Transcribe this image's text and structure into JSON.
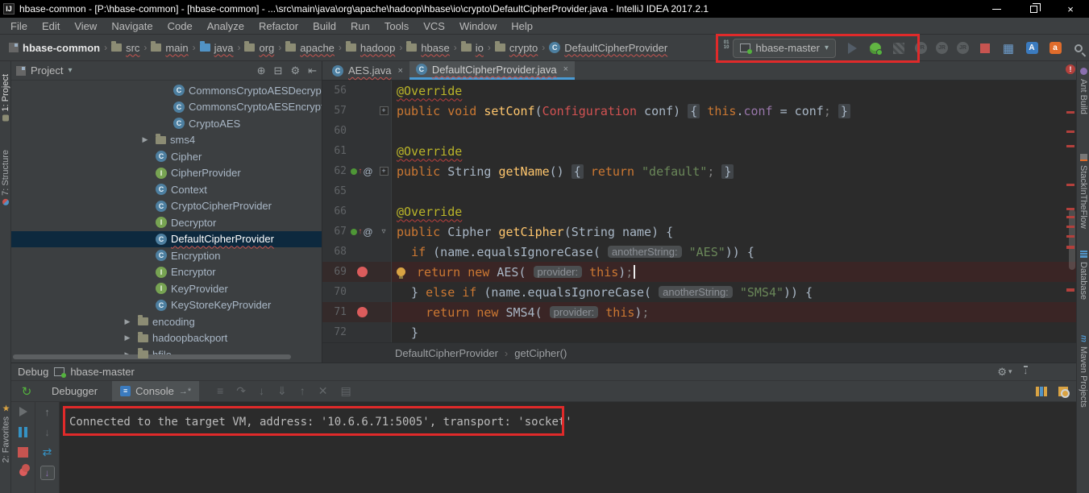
{
  "window": {
    "title": "hbase-common - [P:\\hbase-common] - [hbase-common] - ...\\src\\main\\java\\org\\apache\\hadoop\\hbase\\io\\crypto\\DefaultCipherProvider.java - IntelliJ IDEA 2017.2.1",
    "app_icon": "IJ"
  },
  "colors": {
    "accent": "#4A9BD5",
    "breakpoint": "#DB5C5C",
    "annotation_red": "#E02A2A",
    "selection": "#0D293E",
    "editor_bg": "#2B2B2B",
    "panel_bg": "#3C3F41"
  },
  "menu_bar": {
    "items": [
      "File",
      "Edit",
      "View",
      "Navigate",
      "Code",
      "Analyze",
      "Refactor",
      "Build",
      "Run",
      "Tools",
      "VCS",
      "Window",
      "Help"
    ]
  },
  "breadcrumb": {
    "separator": "›",
    "items": [
      {
        "label": "hbase-common",
        "icon": "project",
        "squiggle": false
      },
      {
        "label": "src",
        "icon": "folder",
        "squiggle": true
      },
      {
        "label": "main",
        "icon": "folder",
        "squiggle": true
      },
      {
        "label": "java",
        "icon": "java-folder",
        "squiggle": true
      },
      {
        "label": "org",
        "icon": "package",
        "squiggle": true
      },
      {
        "label": "apache",
        "icon": "package",
        "squiggle": true
      },
      {
        "label": "hadoop",
        "icon": "package",
        "squiggle": true
      },
      {
        "label": "hbase",
        "icon": "package",
        "squiggle": true
      },
      {
        "label": "io",
        "icon": "package",
        "squiggle": true
      },
      {
        "label": "crypto",
        "icon": "package",
        "squiggle": true
      },
      {
        "label": "DefaultCipherProvider",
        "icon": "class",
        "squiggle": true
      }
    ]
  },
  "toolbar": {
    "run_config": "hbase-master",
    "dropdown_arrow": "▾",
    "icons": [
      "update-project-icon",
      "run-button",
      "debug-button",
      "coverage-button",
      "jrebel-run-icon",
      "jrebel-debug-icon",
      "jrebel-remote-icon",
      "stop-button",
      "build-icon",
      "translate-blue-icon",
      "translate-orange-icon",
      "search-icon"
    ]
  },
  "project_panel": {
    "title": "Project",
    "tools": {
      "locate": "⊕",
      "collapse": "⊟",
      "settings": "⚙",
      "hide": "⇤"
    },
    "items": [
      {
        "label": "CommonsCryptoAESDecryptor",
        "icon": "class",
        "depth": 7,
        "arrow": false,
        "selected": false,
        "squiggle": false
      },
      {
        "label": "CommonsCryptoAESEncryptor",
        "icon": "class",
        "depth": 7,
        "arrow": false,
        "selected": false,
        "squiggle": false
      },
      {
        "label": "CryptoAES",
        "icon": "class",
        "depth": 7,
        "arrow": false,
        "selected": false,
        "squiggle": false
      },
      {
        "label": "sms4",
        "icon": "folder",
        "depth": 6,
        "arrow": true,
        "selected": false,
        "squiggle": false
      },
      {
        "label": "Cipher",
        "icon": "class",
        "depth": 6,
        "arrow": false,
        "selected": false,
        "squiggle": false
      },
      {
        "label": "CipherProvider",
        "icon": "interface",
        "depth": 6,
        "arrow": false,
        "selected": false,
        "squiggle": false
      },
      {
        "label": "Context",
        "icon": "class",
        "depth": 6,
        "arrow": false,
        "selected": false,
        "squiggle": false
      },
      {
        "label": "CryptoCipherProvider",
        "icon": "class",
        "depth": 6,
        "arrow": false,
        "selected": false,
        "squiggle": false
      },
      {
        "label": "Decryptor",
        "icon": "interface",
        "depth": 6,
        "arrow": false,
        "selected": false,
        "squiggle": false
      },
      {
        "label": "DefaultCipherProvider",
        "icon": "class",
        "depth": 6,
        "arrow": false,
        "selected": true,
        "squiggle": true
      },
      {
        "label": "Encryption",
        "icon": "class",
        "depth": 6,
        "arrow": false,
        "selected": false,
        "squiggle": false
      },
      {
        "label": "Encryptor",
        "icon": "interface",
        "depth": 6,
        "arrow": false,
        "selected": false,
        "squiggle": false
      },
      {
        "label": "KeyProvider",
        "icon": "interface",
        "depth": 6,
        "arrow": false,
        "selected": false,
        "squiggle": false
      },
      {
        "label": "KeyStoreKeyProvider",
        "icon": "class",
        "depth": 6,
        "arrow": false,
        "selected": false,
        "squiggle": false
      },
      {
        "label": "encoding",
        "icon": "folder",
        "depth": 5,
        "arrow": true,
        "selected": false,
        "squiggle": false
      },
      {
        "label": "hadoopbackport",
        "icon": "folder",
        "depth": 5,
        "arrow": true,
        "selected": false,
        "squiggle": false
      },
      {
        "label": "hfile",
        "icon": "folder",
        "depth": 5,
        "arrow": true,
        "selected": false,
        "squiggle": false
      }
    ]
  },
  "editor": {
    "tabs": [
      {
        "label": "AES.java",
        "active": false
      },
      {
        "label": "DefaultCipherProvider.java",
        "active": true
      }
    ],
    "close_glyph": "×",
    "breadcrumb": {
      "class": "DefaultCipherProvider",
      "method": "getCipher()",
      "separator": "›"
    },
    "code_lines": [
      {
        "num": "56",
        "fold": "",
        "override": false,
        "breakpoint": false,
        "highlight": false,
        "segments": [
          {
            "t": "@Override",
            "s": "ann"
          }
        ]
      },
      {
        "num": "57",
        "fold": "plus",
        "override": false,
        "breakpoint": false,
        "highlight": false,
        "segments": [
          {
            "t": "public void ",
            "s": "kw"
          },
          {
            "t": "setConf",
            "s": "mth"
          },
          {
            "t": "(",
            "s": "pln"
          },
          {
            "t": "Configuration",
            "s": "err"
          },
          {
            "t": " conf) ",
            "s": "pln"
          },
          {
            "t": "{",
            "s": "fold"
          },
          {
            "t": " ",
            "s": "pln"
          },
          {
            "t": "this",
            "s": "kw"
          },
          {
            "t": ".",
            "s": "pln"
          },
          {
            "t": "conf",
            "s": "fld"
          },
          {
            "t": " = conf",
            "s": "pln"
          },
          {
            "t": ";",
            "s": "gray"
          },
          {
            "t": " ",
            "s": "pln"
          },
          {
            "t": "}",
            "s": "fold"
          }
        ]
      },
      {
        "num": "60",
        "fold": "",
        "override": false,
        "breakpoint": false,
        "highlight": false,
        "segments": []
      },
      {
        "num": "61",
        "fold": "",
        "override": false,
        "breakpoint": false,
        "highlight": false,
        "segments": [
          {
            "t": "@Override",
            "s": "ann"
          }
        ]
      },
      {
        "num": "62",
        "fold": "plus",
        "override": true,
        "breakpoint": false,
        "highlight": false,
        "segments": [
          {
            "t": "public ",
            "s": "kw"
          },
          {
            "t": "String ",
            "s": "pln"
          },
          {
            "t": "getName",
            "s": "mth"
          },
          {
            "t": "() ",
            "s": "pln"
          },
          {
            "t": "{",
            "s": "fold"
          },
          {
            "t": " ",
            "s": "pln"
          },
          {
            "t": "return ",
            "s": "kw"
          },
          {
            "t": "\"default\"",
            "s": "str"
          },
          {
            "t": ";",
            "s": "gray"
          },
          {
            "t": " ",
            "s": "pln"
          },
          {
            "t": "}",
            "s": "fold"
          }
        ]
      },
      {
        "num": "65",
        "fold": "",
        "override": false,
        "breakpoint": false,
        "highlight": false,
        "segments": []
      },
      {
        "num": "66",
        "fold": "",
        "override": false,
        "breakpoint": false,
        "highlight": false,
        "segments": [
          {
            "t": "@Override",
            "s": "ann"
          }
        ]
      },
      {
        "num": "67",
        "fold": "open",
        "override": true,
        "breakpoint": false,
        "highlight": false,
        "segments": [
          {
            "t": "public ",
            "s": "kw"
          },
          {
            "t": "Cipher ",
            "s": "pln"
          },
          {
            "t": "getCipher",
            "s": "mth"
          },
          {
            "t": "(String name) {",
            "s": "pln"
          }
        ]
      },
      {
        "num": "68",
        "fold": "",
        "override": false,
        "breakpoint": false,
        "highlight": false,
        "segments": [
          {
            "t": "  ",
            "s": "pln"
          },
          {
            "t": "if ",
            "s": "kw"
          },
          {
            "t": "(name.equalsIgnoreCase( ",
            "s": "pln"
          },
          {
            "t": "anotherString:",
            "s": "hint"
          },
          {
            "t": " ",
            "s": "pln"
          },
          {
            "t": "\"AES\"",
            "s": "str"
          },
          {
            "t": ")) {",
            "s": "pln"
          }
        ]
      },
      {
        "num": "69",
        "fold": "",
        "override": false,
        "breakpoint": true,
        "highlight": true,
        "segments": [
          {
            "t": "",
            "s": "bulb"
          },
          {
            "t": " ",
            "s": "pln"
          },
          {
            "t": "return new ",
            "s": "kw"
          },
          {
            "t": "AES( ",
            "s": "pln"
          },
          {
            "t": "provider:",
            "s": "hint"
          },
          {
            "t": " ",
            "s": "pln"
          },
          {
            "t": "this",
            "s": "kw"
          },
          {
            "t": ")",
            "s": "pln"
          },
          {
            "t": ";",
            "s": "gray"
          },
          {
            "t": "",
            "s": "caret"
          }
        ]
      },
      {
        "num": "70",
        "fold": "",
        "override": false,
        "breakpoint": false,
        "highlight": false,
        "segments": [
          {
            "t": "  } ",
            "s": "pln"
          },
          {
            "t": "else if ",
            "s": "kw"
          },
          {
            "t": "(name.equalsIgnoreCase( ",
            "s": "pln"
          },
          {
            "t": "anotherString:",
            "s": "hint"
          },
          {
            "t": " ",
            "s": "pln"
          },
          {
            "t": "\"SMS4\"",
            "s": "str"
          },
          {
            "t": ")) {",
            "s": "pln"
          }
        ]
      },
      {
        "num": "71",
        "fold": "",
        "override": false,
        "breakpoint": true,
        "highlight": true,
        "segments": [
          {
            "t": "    ",
            "s": "pln"
          },
          {
            "t": "return new ",
            "s": "kw"
          },
          {
            "t": "SMS4( ",
            "s": "pln"
          },
          {
            "t": "provider:",
            "s": "hint"
          },
          {
            "t": " ",
            "s": "pln"
          },
          {
            "t": "this",
            "s": "kw"
          },
          {
            "t": ")",
            "s": "pln"
          },
          {
            "t": ";",
            "s": "gray"
          }
        ]
      },
      {
        "num": "72",
        "fold": "",
        "override": false,
        "breakpoint": false,
        "highlight": false,
        "segments": [
          {
            "t": "  }",
            "s": "pln"
          }
        ]
      }
    ]
  },
  "debug": {
    "title": "Debug",
    "config": "hbase-master",
    "tabs": [
      {
        "label": "Debugger",
        "active": false,
        "icon": false
      },
      {
        "label": "Console",
        "active": true,
        "icon": true
      }
    ],
    "console_text": "Connected to the target VM, address: '10.6.6.71:5005', transport: 'socket'",
    "tools": {
      "settings": "⚙",
      "rerun": "↻",
      "up": "↑",
      "down": "↓",
      "refresh": "⇄",
      "layout": "↓"
    },
    "step_icons": [
      "≡",
      "↷",
      "↓",
      "⇓",
      "↑",
      "✕",
      "▤"
    ]
  },
  "left_strip": {
    "items": [
      "1: Project",
      "7: Structure",
      "2: Favorites"
    ]
  },
  "right_strip": {
    "items": [
      "Ant Build",
      "StackInTheFlow",
      "Database",
      "Maven Projects"
    ]
  },
  "glyphs": {
    "tree_arrow": "▶",
    "crumb_sep": "›",
    "minimize": "",
    "close": "×",
    "console_tab_arrow": "→*",
    "gear_caret": "▾"
  }
}
